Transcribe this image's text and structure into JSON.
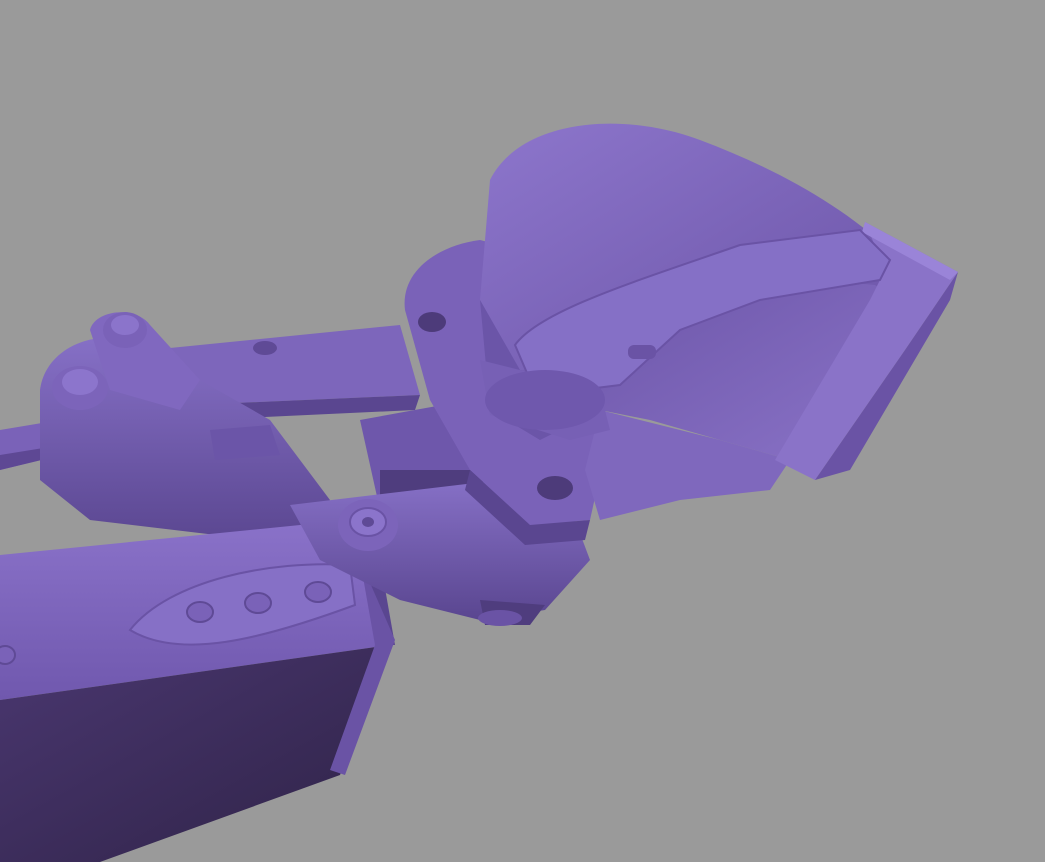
{
  "scene": {
    "background_color": "#9a9a9a",
    "model_color": "#7b63b8",
    "model_highlight": "#9580d2",
    "model_shadow": "#3e2e5c"
  }
}
